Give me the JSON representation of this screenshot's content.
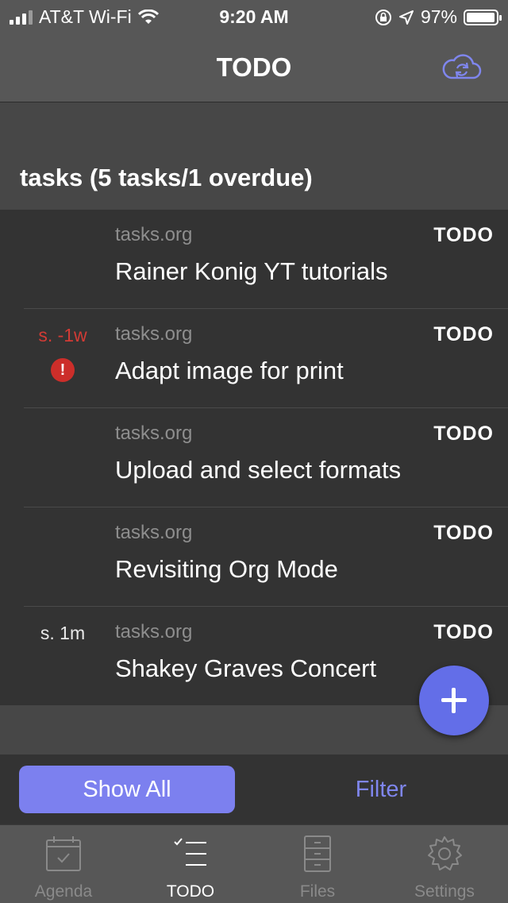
{
  "status_bar": {
    "carrier": "AT&T Wi-Fi",
    "time": "9:20 AM",
    "battery_percent": "97%"
  },
  "nav": {
    "title": "TODO",
    "sync_icon": "cloud-sync-icon"
  },
  "section": {
    "title": "tasks (5 tasks/1 overdue)"
  },
  "tasks": [
    {
      "file": "tasks.org",
      "state": "TODO",
      "title": "Rainer Konig YT tutorials",
      "meta": "",
      "overdue": false
    },
    {
      "file": "tasks.org",
      "state": "TODO",
      "title": "Adapt image for print",
      "meta": "s. -1w",
      "overdue": true,
      "warning_glyph": "!"
    },
    {
      "file": "tasks.org",
      "state": "TODO",
      "title": "Upload and select formats",
      "meta": "",
      "overdue": false
    },
    {
      "file": "tasks.org",
      "state": "TODO",
      "title": "Revisiting Org Mode",
      "meta": "",
      "overdue": false
    },
    {
      "file": "tasks.org",
      "state": "TODO",
      "title": "Shakey Graves Concert",
      "meta": "s. 1m",
      "overdue": false
    }
  ],
  "filter_bar": {
    "show_all_label": "Show All",
    "filter_label": "Filter"
  },
  "tab_bar": {
    "tabs": [
      {
        "label": "Agenda",
        "icon": "calendar-icon",
        "active": false
      },
      {
        "label": "TODO",
        "icon": "checklist-icon",
        "active": true
      },
      {
        "label": "Files",
        "icon": "file-cabinet-icon",
        "active": false
      },
      {
        "label": "Settings",
        "icon": "gear-icon",
        "active": false
      }
    ]
  },
  "colors": {
    "accent": "#636ee8",
    "overdue": "#d23b35",
    "background": "#333333",
    "bar": "#575757"
  }
}
